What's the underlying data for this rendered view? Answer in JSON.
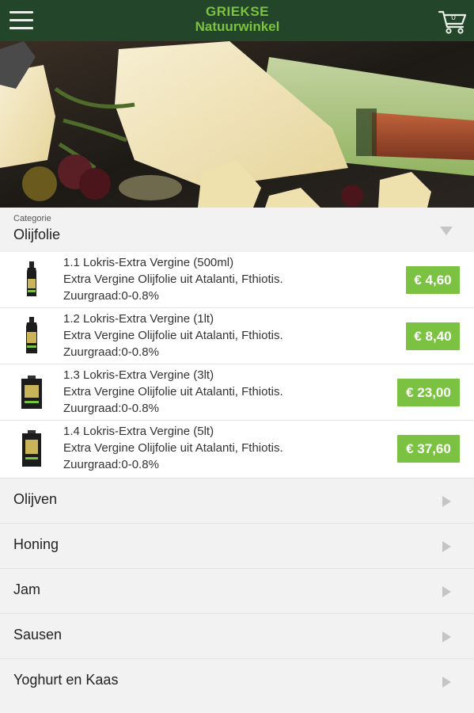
{
  "header": {
    "brand_line1": "GRIEKSE",
    "brand_line2": "Natuurwinkel",
    "cart_count": "0",
    "bar_color": "#23462a",
    "brand_color": "#7bc142"
  },
  "category": {
    "label": "Categorie",
    "selected": "Olijfolie"
  },
  "products": [
    {
      "name": "1.1 Lokris-Extra Vergine (500ml)",
      "desc": "Extra Vergine Olijfolie uit Atalanti, Fthiotis.",
      "acidity": "Zuurgraad:0-0.8%",
      "price": "€ 4,60"
    },
    {
      "name": "1.2 Lokris-Extra Vergine (1lt)",
      "desc": "Extra Vergine Olijfolie uit Atalanti, Fthiotis.",
      "acidity": "Zuurgraad:0-0.8%",
      "price": "€ 8,40"
    },
    {
      "name": "1.3 Lokris-Extra Vergine (3lt)",
      "desc": "Extra Vergine Olijfolie uit Atalanti, Fthiotis.",
      "acidity": "Zuurgraad:0-0.8%",
      "price": "€ 23,00"
    },
    {
      "name": "1.4 Lokris-Extra Vergine (5lt)",
      "desc": "Extra Vergine Olijfolie uit Atalanti, Fthiotis.",
      "acidity": "Zuurgraad:0-0.8%",
      "price": "€ 37,60"
    }
  ],
  "other_categories": [
    {
      "label": "Olijven"
    },
    {
      "label": "Honing"
    },
    {
      "label": "Jam"
    },
    {
      "label": "Sausen"
    },
    {
      "label": "Yoghurt en Kaas"
    }
  ],
  "colors": {
    "price_badge": "#7cc242",
    "background": "#f2f2f2"
  },
  "icons": {
    "menu": "hamburger-menu-icon",
    "cart": "shopping-cart-icon",
    "expand": "caret-down-icon",
    "row": "caret-right-icon"
  }
}
